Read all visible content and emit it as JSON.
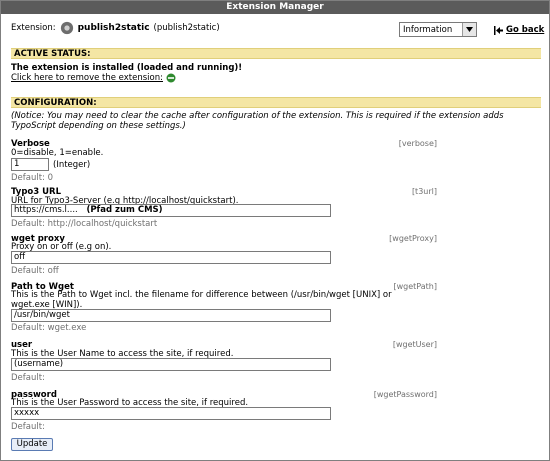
{
  "window": {
    "title": "Extension Manager"
  },
  "extension": {
    "label": "Extension:",
    "name": "publish2static",
    "key_paren": "(publish2static)",
    "icon": "gear-icon"
  },
  "menu": {
    "selected": "Information"
  },
  "go_back": {
    "label": "Go back",
    "icon": "arrow-back-icon"
  },
  "active_status": {
    "heading": "ACTIVE STATUS:",
    "installed_text": "The extension is installed (loaded and running)!",
    "remove_link": "Click here to remove the extension:",
    "remove_icon": "remove-icon"
  },
  "configuration": {
    "heading": "CONFIGURATION:",
    "notice": "(Notice: You may need to clear the cache after configuration of the extension. This is required if the extension adds TypoScript depending on these settings.)",
    "fields": [
      {
        "title": "Verbose",
        "key": "[verbose]",
        "description": "0=disable, 1=enable.",
        "value": "1",
        "suffix": "(Integer)",
        "default": "Default: 0"
      },
      {
        "title": "Typo3 URL",
        "key": "[t3url]",
        "description": "URL for Typo3-Server (e.g http://localhost/quickstart).",
        "value": "https://cms.l....",
        "annotation": "(Pfad zum CMS)",
        "default": "Default: http://localhost/quickstart"
      },
      {
        "title": "wget proxy",
        "key": "[wgetProxy]",
        "description": "Proxy on or off (e.g on).",
        "value": "off",
        "default": "Default: off"
      },
      {
        "title": "Path to Wget",
        "key": "[wgetPath]",
        "description": "This is the Path to Wget incl. the filename for difference between (/usr/bin/wget [UNIX] or wget.exe [WIN]).",
        "value": "/usr/bin/wget",
        "default": "Default: wget.exe"
      },
      {
        "title": "user",
        "key": "[wgetUser]",
        "description": "This is the User Name to access the site, if required.",
        "value": "(username)",
        "default": "Default:"
      },
      {
        "title": "password",
        "key": "[wgetPassword]",
        "description": "This is the User Password to access the site, if required.",
        "value": "xxxxx",
        "default": "Default:"
      }
    ]
  },
  "actions": {
    "update_label": "Update"
  },
  "colors": {
    "titlebar": "#5b5b5b",
    "section_bar": "#f4e6a4",
    "muted_text": "#707070"
  }
}
